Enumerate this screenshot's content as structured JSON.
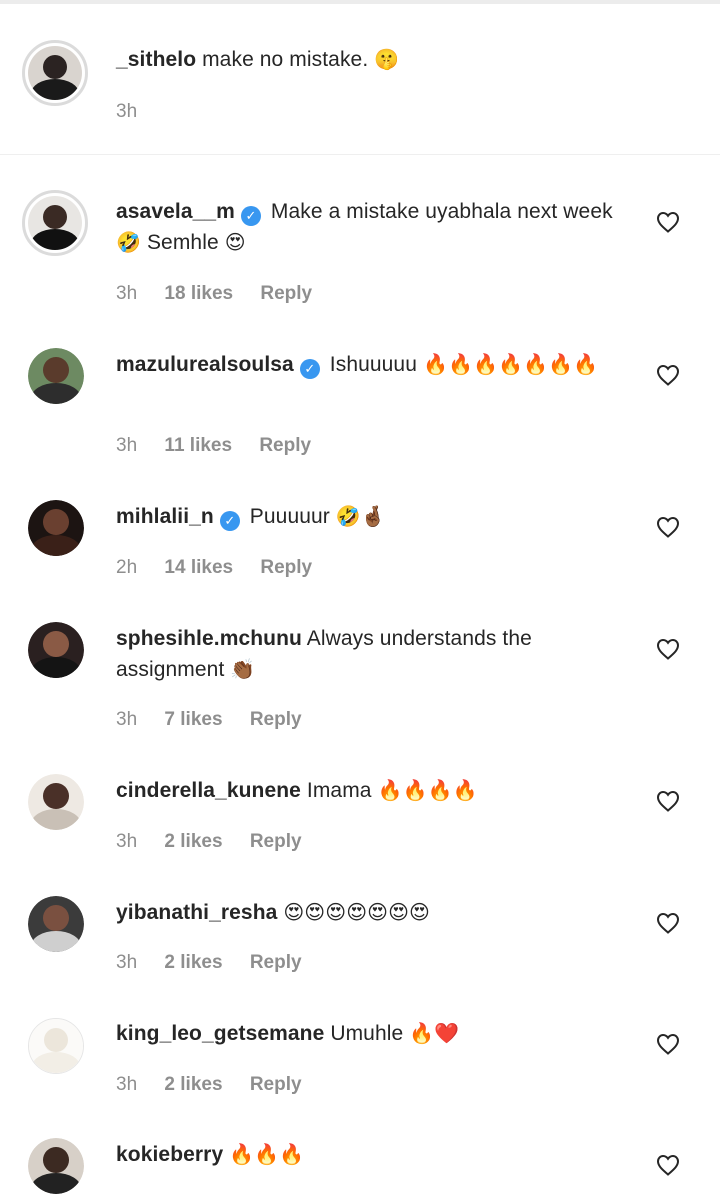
{
  "caption": {
    "username": "_sithelo",
    "text": "make no mistake.",
    "emoji": "🤫",
    "time": "3h"
  },
  "comments": [
    {
      "username": "asavela__m",
      "verified": true,
      "text": "Make a mistake uyabhala next week",
      "emoji1": "🤣",
      "text2": "Semhle",
      "emoji2": "😍",
      "time": "3h",
      "likes": "18 likes",
      "reply": "Reply"
    },
    {
      "username": "mazulurealsoulsa",
      "verified": true,
      "text": "Ishuuuuu",
      "emoji": "🔥🔥🔥🔥🔥🔥🔥",
      "time": "3h",
      "likes": "11 likes",
      "reply": "Reply"
    },
    {
      "username": "mihlalii_n",
      "verified": true,
      "text": "Puuuuur",
      "emoji": "🤣🤞🏾",
      "time": "2h",
      "likes": "14 likes",
      "reply": "Reply"
    },
    {
      "username": "sphesihle.mchunu",
      "verified": false,
      "text": "Always understands the assignment",
      "emoji": "👏🏾",
      "time": "3h",
      "likes": "7 likes",
      "reply": "Reply"
    },
    {
      "username": "cinderella_kunene",
      "verified": false,
      "text": "Imama",
      "emoji": "🔥🔥🔥🔥",
      "time": "3h",
      "likes": "2 likes",
      "reply": "Reply"
    },
    {
      "username": "yibanathi_resha",
      "verified": false,
      "text": "",
      "emoji": "😍😍😍😍😍😍😍",
      "time": "3h",
      "likes": "2 likes",
      "reply": "Reply"
    },
    {
      "username": "king_leo_getsemane",
      "verified": false,
      "text": "Umuhle",
      "emoji": "🔥❤️",
      "time": "3h",
      "likes": "2 likes",
      "reply": "Reply"
    },
    {
      "username": "kokieberry",
      "verified": false,
      "text": "",
      "emoji": "🔥🔥🔥"
    }
  ],
  "colors": {
    "text": "#262626",
    "meta": "#8e8e8e",
    "verified_badge": "#3897f0",
    "divider": "#efefef"
  },
  "icons": {
    "like": "heart-outline-icon",
    "verified": "verified-badge-icon"
  }
}
